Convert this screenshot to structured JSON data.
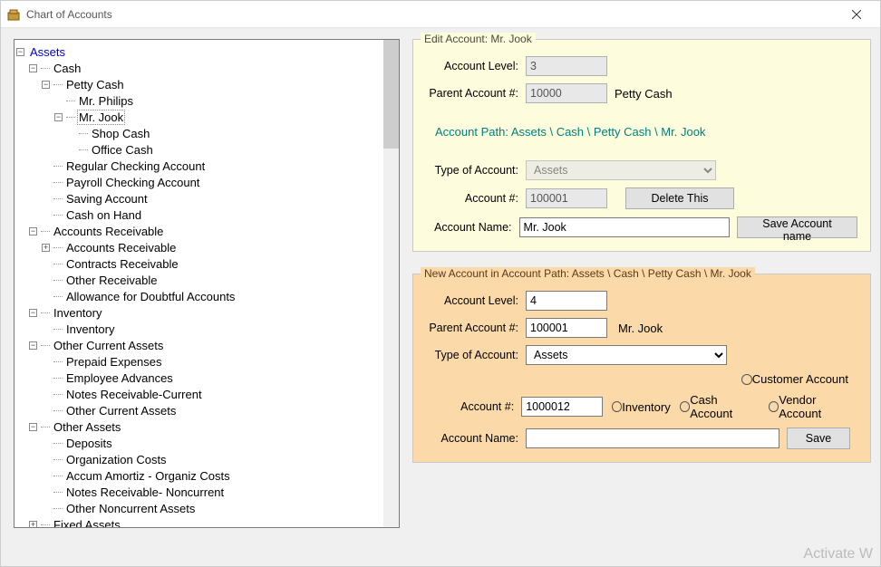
{
  "window": {
    "title": "Chart of Accounts"
  },
  "tree": {
    "root": {
      "label": "Assets",
      "children": [
        {
          "label": "Cash",
          "expanded": true,
          "children": [
            {
              "label": "Petty Cash",
              "expanded": true,
              "children": [
                {
                  "label": "Mr. Philips"
                },
                {
                  "label": "Mr. Jook",
                  "selected": true,
                  "expanded": true,
                  "children": [
                    {
                      "label": "Shop Cash"
                    },
                    {
                      "label": "Office Cash"
                    }
                  ]
                }
              ]
            },
            {
              "label": "Regular Checking Account"
            },
            {
              "label": "Payroll Checking Account"
            },
            {
              "label": "Saving Account"
            },
            {
              "label": "Cash on Hand"
            }
          ]
        },
        {
          "label": "Accounts Receivable",
          "expanded": true,
          "children": [
            {
              "label": "Accounts Receivable",
              "hasHiddenChildren": true
            },
            {
              "label": "Contracts Receivable"
            },
            {
              "label": "Other Receivable"
            },
            {
              "label": "Allowance for Doubtful Accounts"
            }
          ]
        },
        {
          "label": "Inventory",
          "expanded": true,
          "children": [
            {
              "label": "Inventory"
            }
          ]
        },
        {
          "label": "Other Current Assets",
          "expanded": true,
          "children": [
            {
              "label": "Prepaid Expenses"
            },
            {
              "label": "Employee Advances"
            },
            {
              "label": "Notes Receivable-Current"
            },
            {
              "label": "Other Current Assets"
            }
          ]
        },
        {
          "label": "Other Assets",
          "expanded": true,
          "children": [
            {
              "label": "Deposits"
            },
            {
              "label": "Organization Costs"
            },
            {
              "label": "Accum Amortiz - Organiz Costs"
            },
            {
              "label": "Notes Receivable- Noncurrent"
            },
            {
              "label": "Other Noncurrent Assets"
            }
          ]
        },
        {
          "label": "Fixed Assets",
          "hasHiddenChildren": true
        }
      ]
    }
  },
  "edit": {
    "legend": "Edit Account: Mr. Jook",
    "labels": {
      "level": "Account Level:",
      "parent": "Parent Account #:",
      "pathPrefix": "Account Path:  ",
      "type": "Type of Account:",
      "number": "Account #:",
      "name": "Account Name:"
    },
    "level": "3",
    "parentNumber": "10000",
    "parentName": "Petty Cash",
    "path": "Assets \\ Cash \\ Petty Cash \\ Mr. Jook",
    "type": "Assets",
    "number": "100001",
    "name": "Mr. Jook",
    "buttons": {
      "delete": "Delete This",
      "save": "Save Account name"
    }
  },
  "newAcct": {
    "legendPrefix": "New Account in Account Path:  ",
    "legendPath": "Assets \\ Cash \\ Petty Cash \\ Mr. Jook",
    "labels": {
      "level": "Account Level:",
      "parent": "Parent Account #:",
      "type": "Type of Account:",
      "number": "Account #:",
      "name": "Account Name:"
    },
    "level": "4",
    "parentNumber": "100001",
    "parentName": "Mr. Jook",
    "type": "Assets",
    "number": "1000012",
    "name": "",
    "radios": {
      "customer": "Customer Account",
      "inventory": "Inventory",
      "cash": "Cash Account",
      "vendor": "Vendor Account"
    },
    "buttons": {
      "save": "Save"
    }
  },
  "watermark": "Activate W"
}
